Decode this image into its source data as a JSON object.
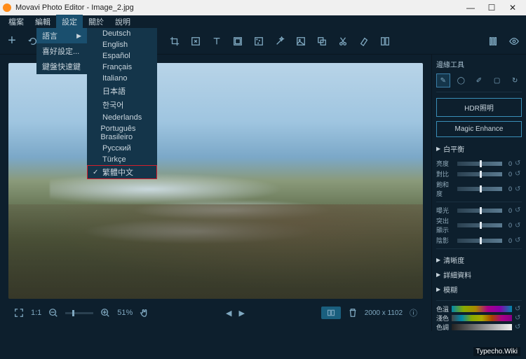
{
  "window": {
    "title": "Movavi Photo Editor - Image_2.jpg"
  },
  "menubar": [
    "檔案",
    "編輯",
    "設定",
    "關於",
    "說明"
  ],
  "settings_menu": {
    "language": "語言",
    "preferences": "喜好設定...",
    "shortcuts": "鍵盤快速鍵"
  },
  "languages": [
    "Deutsch",
    "English",
    "Español",
    "Français",
    "Italiano",
    "日本語",
    "한국어",
    "Nederlands",
    "Português Brasileiro",
    "Русский",
    "Türkçe",
    "繁體中文"
  ],
  "status": {
    "ratio": "1:1",
    "zoom": "51%",
    "dimensions": "2000 x 1102"
  },
  "sidebar": {
    "title": "邊緣工具",
    "hdr": "HDR照明",
    "magic": "Magic Enhance",
    "wb": "白平衡",
    "sliders1": {
      "brightness": "亮度",
      "contrast": "對比",
      "saturation": "飽和度"
    },
    "sliders2": {
      "exposure": "曝光",
      "highlights": "突出顯示",
      "shadows": "陰影"
    },
    "sliders3": {
      "sharpness": "清晰度",
      "detail": "詳細資料",
      "blur": "模糊"
    },
    "color_labels": {
      "temp": "色溫",
      "tint": "淺色",
      "hue": "色調"
    },
    "zero": "0",
    "reset": "重設"
  },
  "watermark": "Typecho.Wiki"
}
